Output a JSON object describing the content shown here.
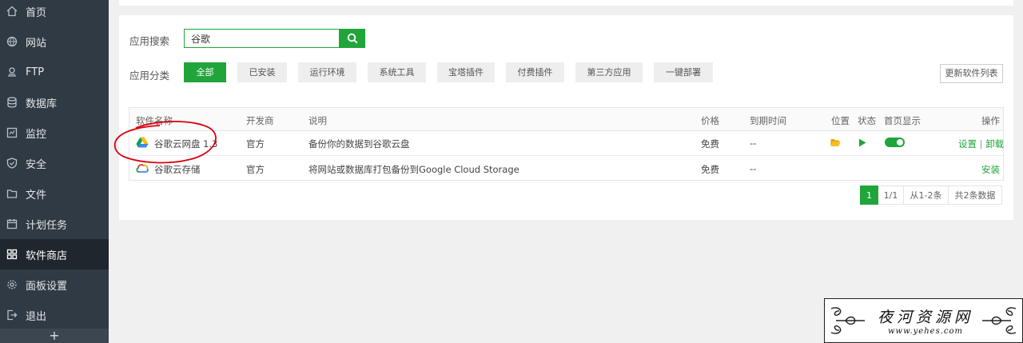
{
  "sidebar": {
    "items": [
      {
        "label": "首页",
        "icon": "home-icon"
      },
      {
        "label": "网站",
        "icon": "globe-icon"
      },
      {
        "label": "FTP",
        "icon": "ftp-icon"
      },
      {
        "label": "数据库",
        "icon": "database-icon"
      },
      {
        "label": "监控",
        "icon": "monitor-icon"
      },
      {
        "label": "安全",
        "icon": "shield-icon"
      },
      {
        "label": "文件",
        "icon": "folder-icon"
      },
      {
        "label": "计划任务",
        "icon": "calendar-icon"
      },
      {
        "label": "软件商店",
        "icon": "apps-grid-icon"
      },
      {
        "label": "面板设置",
        "icon": "gear-icon"
      },
      {
        "label": "退出",
        "icon": "logout-icon"
      }
    ],
    "active_index": 8,
    "bottom_label": "+"
  },
  "search": {
    "label": "应用搜索",
    "value": "谷歌"
  },
  "category": {
    "label": "应用分类",
    "items": [
      "全部",
      "已安装",
      "运行环境",
      "系统工具",
      "宝塔插件",
      "付费插件",
      "第三方应用",
      "一键部署"
    ],
    "active_index": 0,
    "update_label": "更新软件列表"
  },
  "table": {
    "headers": {
      "name": "软件名称",
      "developer": "开发商",
      "description": "说明",
      "price": "价格",
      "expiry": "到期时间",
      "location": "位置",
      "status": "状态",
      "homepage": "首页显示",
      "actions": "操作"
    },
    "rows": [
      {
        "name": "谷歌云网盘 1.3",
        "developer": "官方",
        "description": "备份你的数据到谷歌云盘",
        "price": "免费",
        "expiry": "--",
        "action_settings": "设置",
        "action_sep": "|",
        "action_uninstall": "卸载",
        "icon": "google-drive-icon"
      },
      {
        "name": "谷歌云存储",
        "developer": "官方",
        "description": "将网站或数据库打包备份到Google Cloud Storage",
        "price": "免费",
        "expiry": "--",
        "action_install": "安装",
        "icon": "google-cloud-icon"
      }
    ]
  },
  "pagination": {
    "current": "1",
    "pages": "1/1",
    "range": "从1-2条",
    "total": "共2条数据"
  },
  "watermark": {
    "title": "夜河资源网",
    "url": "www.yehes.com"
  },
  "colors": {
    "accent": "#20a53a",
    "sidebar": "#2f3a45",
    "sidebar_active": "#20262d",
    "annotation": "#d9000d"
  }
}
